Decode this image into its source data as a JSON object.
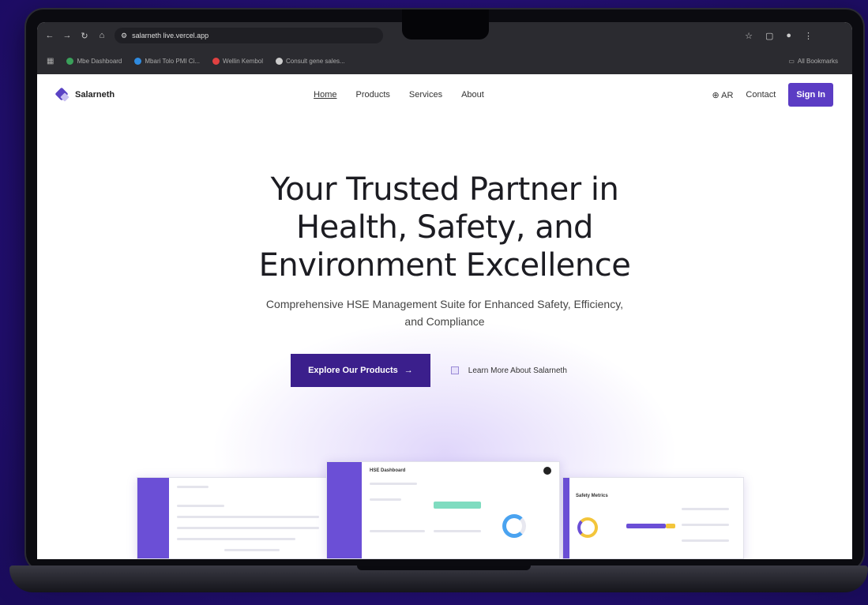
{
  "browser": {
    "url": "salarneth live.vercel.app",
    "bookmarks": [
      {
        "label": "Mbe Dashboard",
        "color": "#3aa05a"
      },
      {
        "label": "Mbari Tolo PMI Ci...",
        "color": "#2f8be0"
      },
      {
        "label": "Wellin Kembol",
        "color": "#e04141"
      },
      {
        "label": "Consult gene sales...",
        "color": "#cccccc"
      }
    ],
    "bookmarks_right": "All Bookmarks"
  },
  "site": {
    "brand": "Salarneth",
    "nav": [
      "Home",
      "Products",
      "Services",
      "About"
    ],
    "lang": "AR",
    "contact": "Contact",
    "signin": "Sign In"
  },
  "hero": {
    "title_line1": "Your Trusted Partner in",
    "title_line2": "Health, Safety, and",
    "title_line3": "Environment Excellence",
    "subtitle": "Comprehensive HSE Management Suite for Enhanced Safety, Efficiency, and Compliance",
    "cta_primary": "Explore Our Products",
    "cta_arrow": "→",
    "cta_secondary": "Learn More About Salarneth"
  },
  "previews": {
    "center_title": "HSE Dashboard",
    "right_title": "Safety Metrics"
  },
  "colors": {
    "accent": "#5b3cc4",
    "cta_dark": "#3b1f8c",
    "background": "#26107a"
  }
}
